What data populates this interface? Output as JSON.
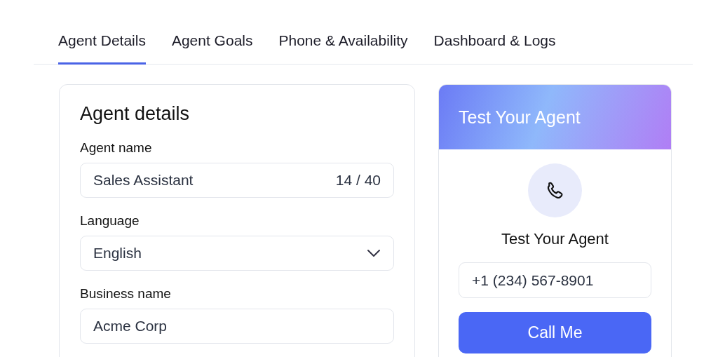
{
  "tabs": [
    {
      "label": "Agent Details",
      "selected": true
    },
    {
      "label": "Agent Goals",
      "selected": false
    },
    {
      "label": "Phone & Availability",
      "selected": false
    },
    {
      "label": "Dashboard & Logs",
      "selected": false
    }
  ],
  "details_card": {
    "title": "Agent details",
    "fields": [
      {
        "kind": "text",
        "label": "Agent name",
        "value": "Sales Assistant",
        "counter": "14 / 40"
      },
      {
        "kind": "select",
        "label": "Language",
        "value": "English"
      },
      {
        "kind": "text",
        "label": "Business name",
        "value": "Acme Corp"
      }
    ]
  },
  "test_card": {
    "header": "Test Your Agent",
    "title": "Test Your Agent",
    "phone": "+1 (234) 567-8901",
    "button": "Call Me"
  }
}
